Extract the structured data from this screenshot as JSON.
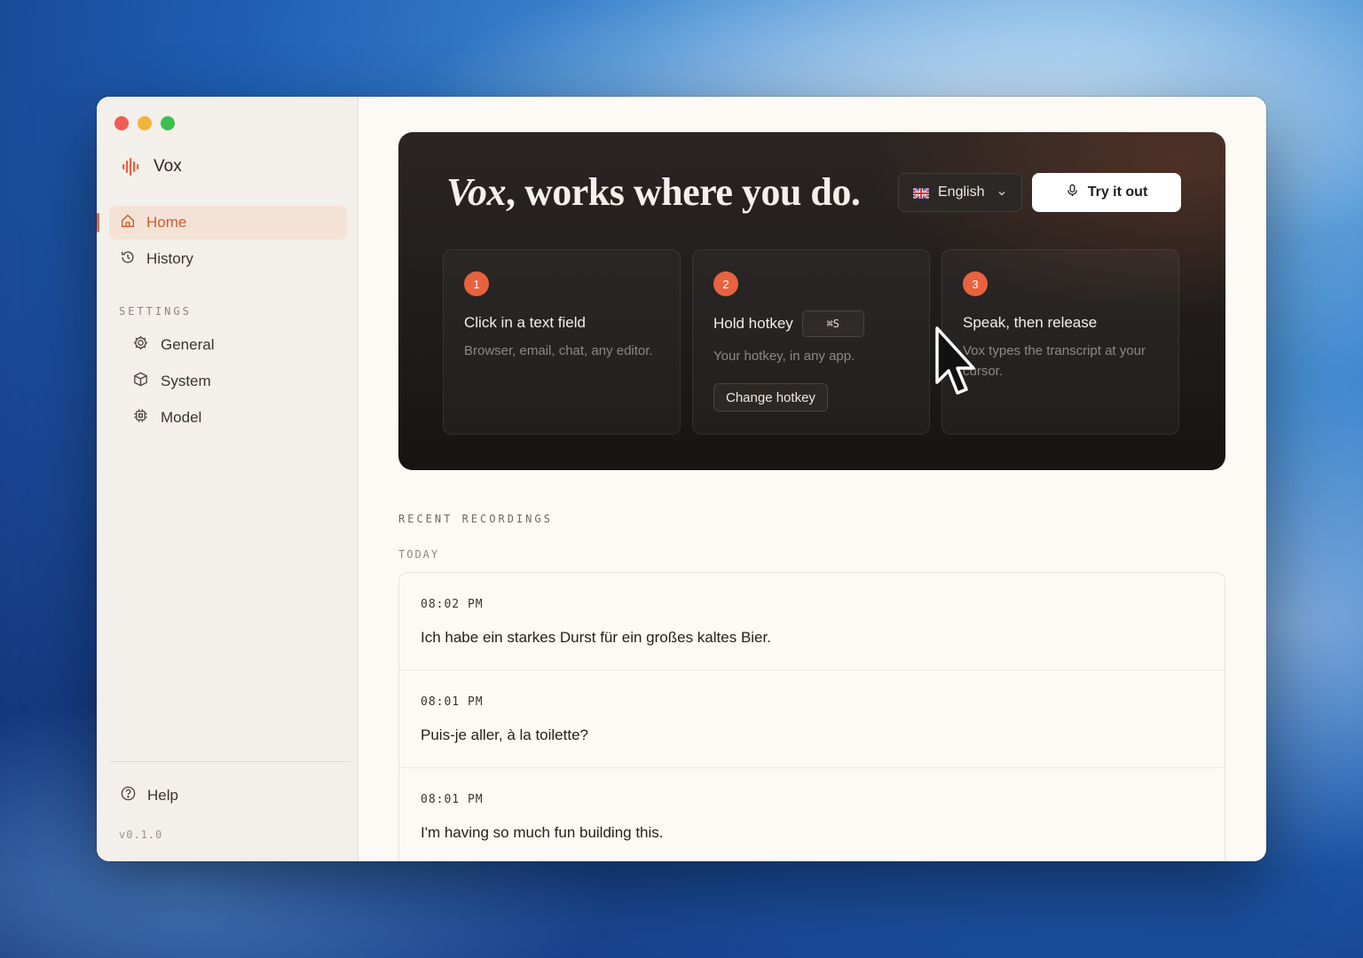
{
  "app": {
    "name": "Vox",
    "accent_color": "#e8623f"
  },
  "sidebar": {
    "nav": [
      {
        "label": "Home",
        "icon": "home-icon",
        "active": true
      },
      {
        "label": "History",
        "icon": "history-icon",
        "active": false
      }
    ],
    "settings_label": "SETTINGS",
    "settings": [
      {
        "label": "General",
        "icon": "gear-icon"
      },
      {
        "label": "System",
        "icon": "cube-icon"
      },
      {
        "label": "Model",
        "icon": "chip-icon"
      }
    ],
    "help_label": "Help",
    "version": "v0.1.0"
  },
  "hero": {
    "title_brand": "Vox",
    "title_rest": ", works where you do.",
    "language": "English",
    "try_button": "Try it out",
    "steps": [
      {
        "num": "1",
        "title": "Click in a text field",
        "desc": "Browser, email, chat, any editor."
      },
      {
        "num": "2",
        "title": "Hold hotkey",
        "hotkey": "⌘S",
        "desc": "Your hotkey, in any app.",
        "button": "Change hotkey"
      },
      {
        "num": "3",
        "title": "Speak, then release",
        "desc": "Vox types the transcript at your cursor."
      }
    ]
  },
  "recent": {
    "label": "RECENT RECORDINGS",
    "group": "TODAY",
    "items": [
      {
        "time": "08:02 PM",
        "text": "Ich habe ein starkes Durst für ein großes kaltes Bier."
      },
      {
        "time": "08:01 PM",
        "text": "Puis-je aller, à la toilette?"
      },
      {
        "time": "08:01 PM",
        "text": "I'm having so much fun building this."
      }
    ]
  }
}
